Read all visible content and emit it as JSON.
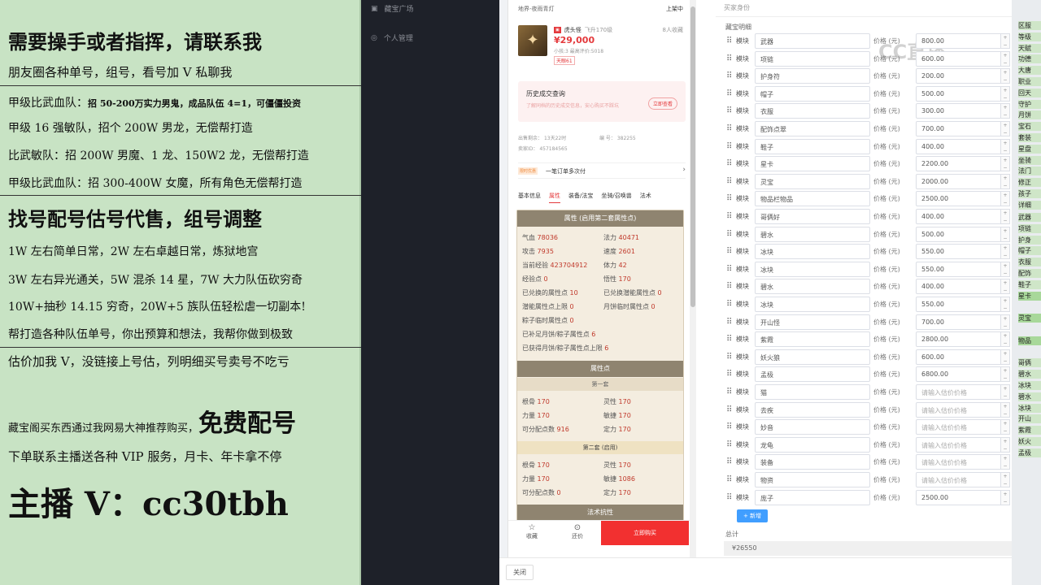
{
  "left_panel": {
    "line1": "需要操手或者指挥，请联系我",
    "line2": "朋友圈各种单号，组号，看号加 V 私聊我",
    "line3": "甲级比武血队：",
    "line3b": "招 50-200万实力男鬼，成品队伍 4=1，可僵僵投资",
    "line4": "甲级 16 强敏队，招个 200W 男龙，无偿帮打造",
    "line5": "比武敏队：招 200W 男魔、1 龙、150W2 龙，无偿帮打造",
    "line6": "甲级比武血队：招 300-400W 女魔，所有角色无偿帮打造",
    "line7": "找号配号估号代售，组号调整",
    "line8": "1W 左右简单日常，2W 左右卓越日常，炼狱地宫",
    "line9": "3W 左右异光通关，5W 混杀 14 星，7W 大力队伍砍穷奇",
    "line10": "10W+抽秒 14.15 穷奇，20W+5 族队伍轻松虐一切副本!",
    "line11": "帮打造各种队伍单号，你出预算和想法，我帮你做到极致",
    "line12": "估价加我 V，没链接上号估，列明细买号卖号不吃亏",
    "line13a": "藏宝阁买东西通过我网易大神推荐购买，",
    "line13b": "免费配号",
    "line14": "下单联系主播送各种 VIP 服务，月卡、年卡拿不停",
    "line15": "主播 V：cc30tbh"
  },
  "nav": {
    "item1": "藏宝广场",
    "item2": "个人管理"
  },
  "phone": {
    "top_left": "地界-夜雨青灯",
    "top_right": "上架中",
    "char_name": "虎头怪",
    "char_level": "飞升170级",
    "favorites": "8人收藏",
    "price": "¥29,000",
    "stats_line": "小孩:3  最高评价:5018",
    "badge": "天眼61",
    "history_title": "历史成交查询",
    "history_desc": "了解同档的历史成交信息，安心购买不踩坑",
    "history_btn": "立即查看",
    "listed_label": "出售剩余：",
    "listed_val": "13天22时",
    "id_label": "编  号：",
    "id_val": "382255",
    "seller_label": "卖家ID：",
    "seller_val": "457184565",
    "promo_tag": "限时优惠",
    "promo_text": "一笔订单多次付",
    "tabs": [
      "基本信息",
      "属性",
      "装备/法宝",
      "坐骑/召唤兽",
      "法术"
    ],
    "attr_header": "属性 (启用第二套属性点)",
    "attrs": [
      [
        "气血",
        "78036",
        "法力",
        "40471"
      ],
      [
        "攻击",
        "7935",
        "速度",
        "2601"
      ],
      [
        "当前经验",
        "423704912",
        "体力",
        "42"
      ],
      [
        "经验点",
        "0",
        "悟性",
        "170"
      ],
      [
        "已兑换的属性点",
        "10",
        "已兑换潜能属性点",
        "0"
      ],
      [
        "潜能属性点上限",
        "0",
        "月饼临时属性点",
        "0"
      ]
    ],
    "attrs_single": [
      [
        "粽子临时属性点",
        "0"
      ],
      [
        "已补足月饼/粽子属性点",
        "6"
      ],
      [
        "已获得月饼/粽子属性点上限",
        "6"
      ]
    ],
    "points_header": "属性点",
    "set1": "第一套",
    "set1_attrs": [
      [
        "根骨",
        "170",
        "灵性",
        "170"
      ],
      [
        "力量",
        "170",
        "敏捷",
        "170"
      ],
      [
        "可分配点数",
        "916",
        "定力",
        "170"
      ]
    ],
    "set2": "第二套 (启用)",
    "set2_attrs": [
      [
        "根骨",
        "170",
        "灵性",
        "170"
      ],
      [
        "力量",
        "170",
        "敏捷",
        "1086"
      ],
      [
        "可分配点数",
        "0",
        "定力",
        "170"
      ]
    ],
    "spell_header": "法术抗性",
    "fav": "收藏",
    "bargain": "还价",
    "buy": "立即购买",
    "close": "关闭"
  },
  "right": {
    "section_title": "买家身份",
    "detail_title": "藏宝明细",
    "module_label": "模块",
    "price_label": "价格 (元)",
    "placeholder": "请输入估价价格",
    "rows": [
      [
        "武器",
        "800.00"
      ],
      [
        "项链",
        "600.00"
      ],
      [
        "护身符",
        "200.00"
      ],
      [
        "帽子",
        "500.00"
      ],
      [
        "衣服",
        "300.00"
      ],
      [
        "配饰点翠",
        "700.00"
      ],
      [
        "鞋子",
        "400.00"
      ],
      [
        "星卡",
        "2200.00"
      ],
      [
        "灵宝",
        "2000.00"
      ],
      [
        "物品栏物品",
        "2500.00"
      ],
      [
        "哥俩好",
        "400.00"
      ],
      [
        "碧水",
        "500.00"
      ],
      [
        "冰块",
        "550.00"
      ],
      [
        "冰块",
        "550.00"
      ],
      [
        "碧水",
        "400.00"
      ],
      [
        "冰块",
        "550.00"
      ],
      [
        "开山怪",
        "700.00"
      ],
      [
        "紫霞",
        "2800.00"
      ],
      [
        "妖火狼",
        "600.00"
      ],
      [
        "孟极",
        "6800.00"
      ],
      [
        "猫",
        ""
      ],
      [
        "去疾",
        ""
      ],
      [
        "妙音",
        ""
      ],
      [
        "龙龟",
        ""
      ],
      [
        "装备",
        ""
      ],
      [
        "物资",
        ""
      ],
      [
        "庞子",
        "2500.00"
      ]
    ],
    "add_btn": "+ 新增",
    "total_label": "总计",
    "total_val": "¥26550"
  },
  "strip": {
    "top": [
      "区服",
      "等级",
      "天赋",
      "功德",
      "大唐",
      "职业",
      "回天",
      "守护",
      "月饼",
      "宝石",
      "套装",
      "星盘",
      "坐骑",
      "法门",
      "修正",
      "孩子",
      "详细"
    ],
    "bottom": [
      "武器",
      "项链",
      "护身",
      "帽子",
      "衣服",
      "配饰",
      "鞋子",
      "星卡",
      "",
      "灵宝",
      "",
      "物品",
      "",
      "哥俩",
      "碧水",
      "冰块",
      "碧水",
      "冰块",
      "开山",
      "紫霞",
      "妖火",
      "孟极"
    ]
  },
  "colors": {
    "price_red": "#e4393c",
    "buy_red": "#f23030",
    "left_bg": "#c8e3c4",
    "dark_nav": "#1e2129"
  },
  "watermark": "CC直播"
}
